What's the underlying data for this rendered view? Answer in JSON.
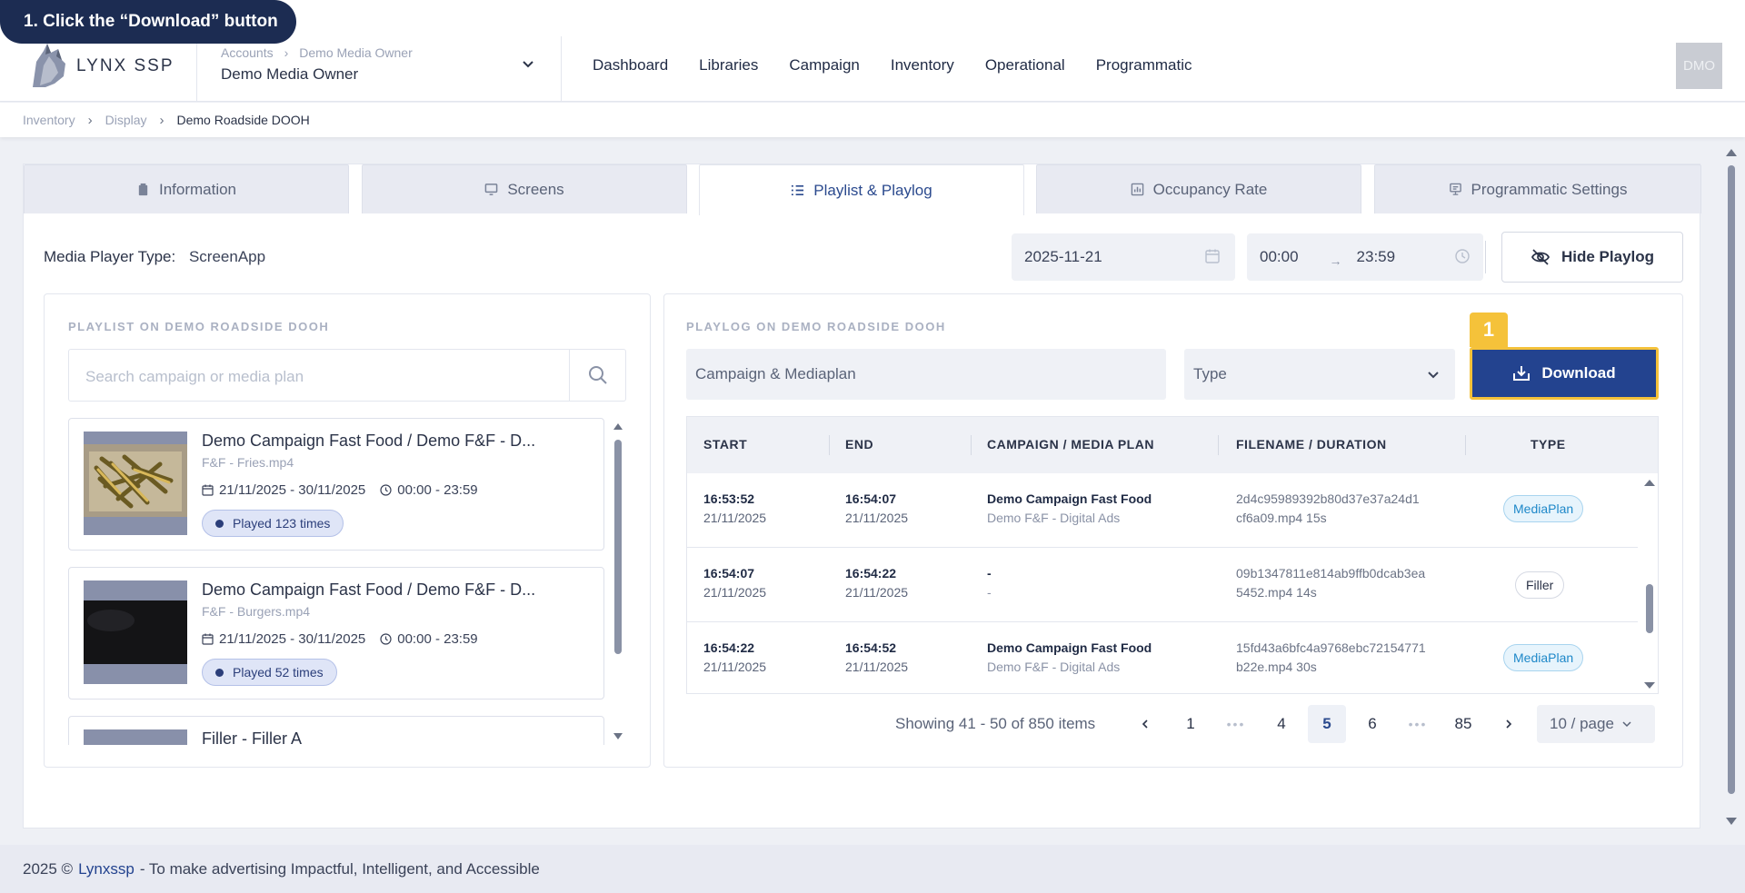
{
  "tooltip": {
    "step": "1. Click the “Download” button"
  },
  "brand": {
    "name": "LYNX SSP"
  },
  "account": {
    "bc1": "Accounts",
    "bc2": "Demo Media Owner",
    "name": "Demo Media Owner"
  },
  "nav": [
    "Dashboard",
    "Libraries",
    "Campaign",
    "Inventory",
    "Operational",
    "Programmatic"
  ],
  "avatar": "DMO",
  "breadcrumb": {
    "a": "Inventory",
    "b": "Display",
    "c": "Demo Roadside DOOH"
  },
  "tabs": {
    "t0": "Information",
    "t1": "Screens",
    "t2": "Playlist & Playlog",
    "t3": "Occupancy Rate",
    "t4": "Programmatic Settings"
  },
  "filters": {
    "media_player_label": "Media Player Type:",
    "media_player_value": "ScreenApp",
    "date": "2025-11-21",
    "time_start": "00:00",
    "time_end": "23:59",
    "hide_label": "Hide Playlog"
  },
  "playlist": {
    "title": "PLAYLIST ON DEMO ROADSIDE DOOH",
    "search_placeholder": "Search campaign or media plan",
    "items": [
      {
        "title": "Demo Campaign Fast Food / Demo F&F - D...",
        "file": "F&F - Fries.mp4",
        "dates": "21/11/2025 - 30/11/2025",
        "time": "00:00 - 23:59",
        "played": "Played 123 times"
      },
      {
        "title": "Demo Campaign Fast Food / Demo F&F - D...",
        "file": "F&F - Burgers.mp4",
        "dates": "21/11/2025 - 30/11/2025",
        "time": "00:00 - 23:59",
        "played": "Played 52 times"
      },
      {
        "title": "Filler - Filler A"
      }
    ]
  },
  "playlog": {
    "title": "PLAYLOG ON DEMO ROADSIDE DOOH",
    "campaign_placeholder": "Campaign & Mediaplan",
    "type_placeholder": "Type",
    "download_label": "Download",
    "highlight_badge": "1",
    "headers": {
      "start": "START",
      "end": "END",
      "campaign": "CAMPAIGN / MEDIA PLAN",
      "filename": "FILENAME / DURATION",
      "type": "TYPE"
    },
    "rows": [
      {
        "start_time": "16:53:52",
        "start_date": "21/11/2025",
        "end_time": "16:54:07",
        "end_date": "21/11/2025",
        "campaign": "Demo Campaign Fast Food",
        "plan": "Demo F&F - Digital Ads",
        "file1": "2d4c95989392b80d37e37a24d1",
        "file2": "cf6a09.mp4 15s",
        "type": "MediaPlan"
      },
      {
        "start_time": "16:54:07",
        "start_date": "21/11/2025",
        "end_time": "16:54:22",
        "end_date": "21/11/2025",
        "campaign": "-",
        "plan": "-",
        "file1": "09b1347811e814ab9ffb0dcab3ea",
        "file2": "5452.mp4 14s",
        "type": "Filler"
      },
      {
        "start_time": "16:54:22",
        "start_date": "21/11/2025",
        "end_time": "16:54:52",
        "end_date": "21/11/2025",
        "campaign": "Demo Campaign Fast Food",
        "plan": "Demo F&F - Digital Ads",
        "file1": "15fd43a6bfc4a9768ebc72154771",
        "file2": "b22e.mp4 30s",
        "type": "MediaPlan"
      }
    ],
    "pagination": {
      "summary": "Showing 41 - 50 of 850 items",
      "p1": "1",
      "dots": "•••",
      "p4": "4",
      "p5": "5",
      "p6": "6",
      "p85": "85",
      "per_page": "10 / page"
    }
  },
  "footer": {
    "year": "2025 ©",
    "link": "Lynxssp",
    "tagline": "- To make advertising Impactful, Intelligent, and Accessible"
  },
  "colors": {
    "primary": "#23438f",
    "highlight": "#f5c23a",
    "navy": "#1c2c52"
  }
}
